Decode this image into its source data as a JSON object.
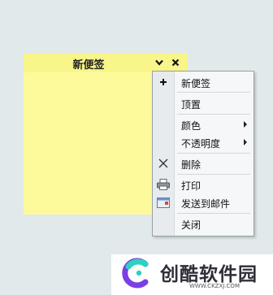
{
  "note": {
    "title": "新便签",
    "collapse_icon": "chevron-down-icon",
    "close_icon": "close-icon"
  },
  "menu": {
    "items": [
      {
        "label": "新便签",
        "icon": "plus-icon",
        "submenu": false
      },
      {
        "label": "顶置",
        "icon": "",
        "submenu": false
      },
      {
        "label": "颜色",
        "icon": "",
        "submenu": true
      },
      {
        "label": "不透明度",
        "icon": "",
        "submenu": true
      },
      {
        "label": "删除",
        "icon": "delete-x-icon",
        "submenu": false
      },
      {
        "label": "打印",
        "icon": "printer-icon",
        "submenu": false
      },
      {
        "label": "发送到邮件",
        "icon": "mail-icon",
        "submenu": false
      },
      {
        "label": "关闭",
        "icon": "",
        "submenu": false
      }
    ]
  },
  "watermark": {
    "name": "创酷软件园",
    "url": "WWW.CKZXJ.COM"
  },
  "colors": {
    "background": "#e2e9ea",
    "note_body": "#fdfa9c",
    "note_titlebar": "#f8f58a",
    "menu_bg": "#f5f7f8"
  }
}
